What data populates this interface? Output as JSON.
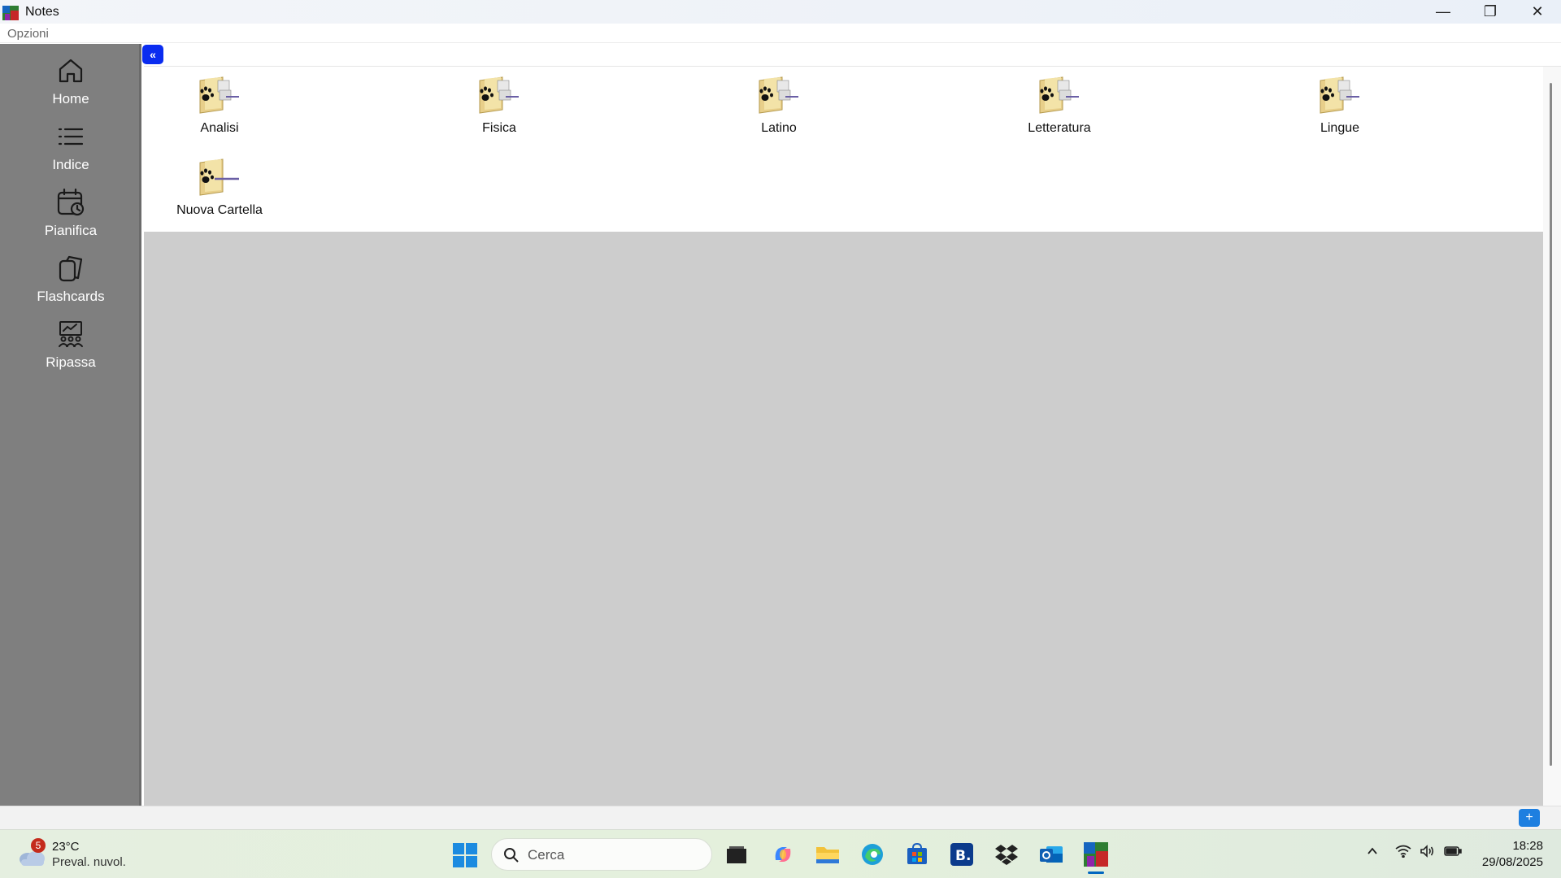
{
  "window": {
    "title": "Notes",
    "minimize_glyph": "—",
    "restore_glyph": "❐",
    "close_glyph": "✕"
  },
  "menu": {
    "options_label": "Opzioni"
  },
  "sidebar": {
    "items": [
      {
        "label": "Home",
        "icon": "home-icon"
      },
      {
        "label": "Indice",
        "icon": "list-icon"
      },
      {
        "label": "Pianifica",
        "icon": "calendar-clock-icon"
      },
      {
        "label": "Flashcards",
        "icon": "cards-icon"
      },
      {
        "label": "Ripassa",
        "icon": "review-icon"
      }
    ]
  },
  "collapse_button": {
    "label": "«"
  },
  "folders": [
    {
      "label": "Analisi"
    },
    {
      "label": "Fisica"
    },
    {
      "label": "Latino"
    },
    {
      "label": "Letteratura"
    },
    {
      "label": "Lingue"
    },
    {
      "label": "Nuova Cartella"
    }
  ],
  "add_button": {
    "label": "+"
  },
  "taskbar": {
    "weather": {
      "badge": "5",
      "temp": "23°C",
      "description": "Preval. nuvol."
    },
    "search": {
      "placeholder": "Cerca"
    },
    "clock": {
      "time": "18:28",
      "date": "29/08/2025"
    }
  },
  "colors": {
    "sidebar": "#7f7f7f",
    "content_gray": "#cdcdcd",
    "accent_blue": "#0a2cf0",
    "add_blue": "#1e7fe0"
  }
}
